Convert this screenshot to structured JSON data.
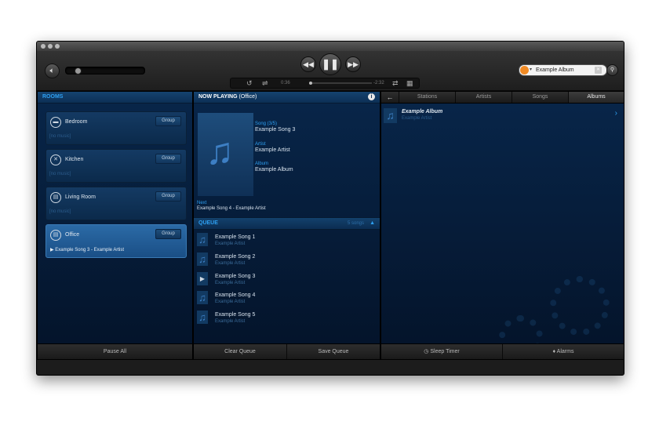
{
  "toolbar": {
    "time_elapsed": "0:36",
    "time_remaining": "-2:32",
    "search_value": "Example Album"
  },
  "rooms_panel": {
    "header": "ROOMS",
    "rooms": [
      {
        "name": "Bedroom",
        "group_label": "Group",
        "status": "[no music]"
      },
      {
        "name": "Kitchen",
        "group_label": "Group",
        "status": "[no music]"
      },
      {
        "name": "Living Room",
        "group_label": "Group",
        "status": "[no music]"
      },
      {
        "name": "Office",
        "group_label": "Group",
        "status": "Example Song 3 - Example Artist"
      }
    ],
    "footer": {
      "pause_all": "Pause All"
    }
  },
  "now_playing": {
    "header_title": "NOW PLAYING",
    "header_room": "(Office)",
    "song_label": "Song (3/5)",
    "song_value": "Example Song 3",
    "artist_label": "Artist",
    "artist_value": "Example Artist",
    "album_label": "Album",
    "album_value": "Example Album",
    "next_label": "Next",
    "next_value": "Example Song 4 - Example Artist"
  },
  "queue": {
    "header": "QUEUE",
    "count": "5 songs",
    "items": [
      {
        "title": "Example Song 1",
        "artist": "Example Artist"
      },
      {
        "title": "Example Song 2",
        "artist": "Example Artist"
      },
      {
        "title": "Example Song 3",
        "artist": "Example Artist"
      },
      {
        "title": "Example Song 4",
        "artist": "Example Artist"
      },
      {
        "title": "Example Song 5",
        "artist": "Example Artist"
      }
    ],
    "footer": {
      "clear": "Clear Queue",
      "save": "Save Queue"
    }
  },
  "music_panel": {
    "tabs": [
      "Stations",
      "Artists",
      "Songs",
      "Albums"
    ],
    "active_tab": "Albums",
    "results": [
      {
        "title": "Example Album",
        "artist": "Example Artist"
      }
    ],
    "footer": {
      "sleep_timer": "Sleep Timer",
      "alarms": "Alarms"
    }
  }
}
